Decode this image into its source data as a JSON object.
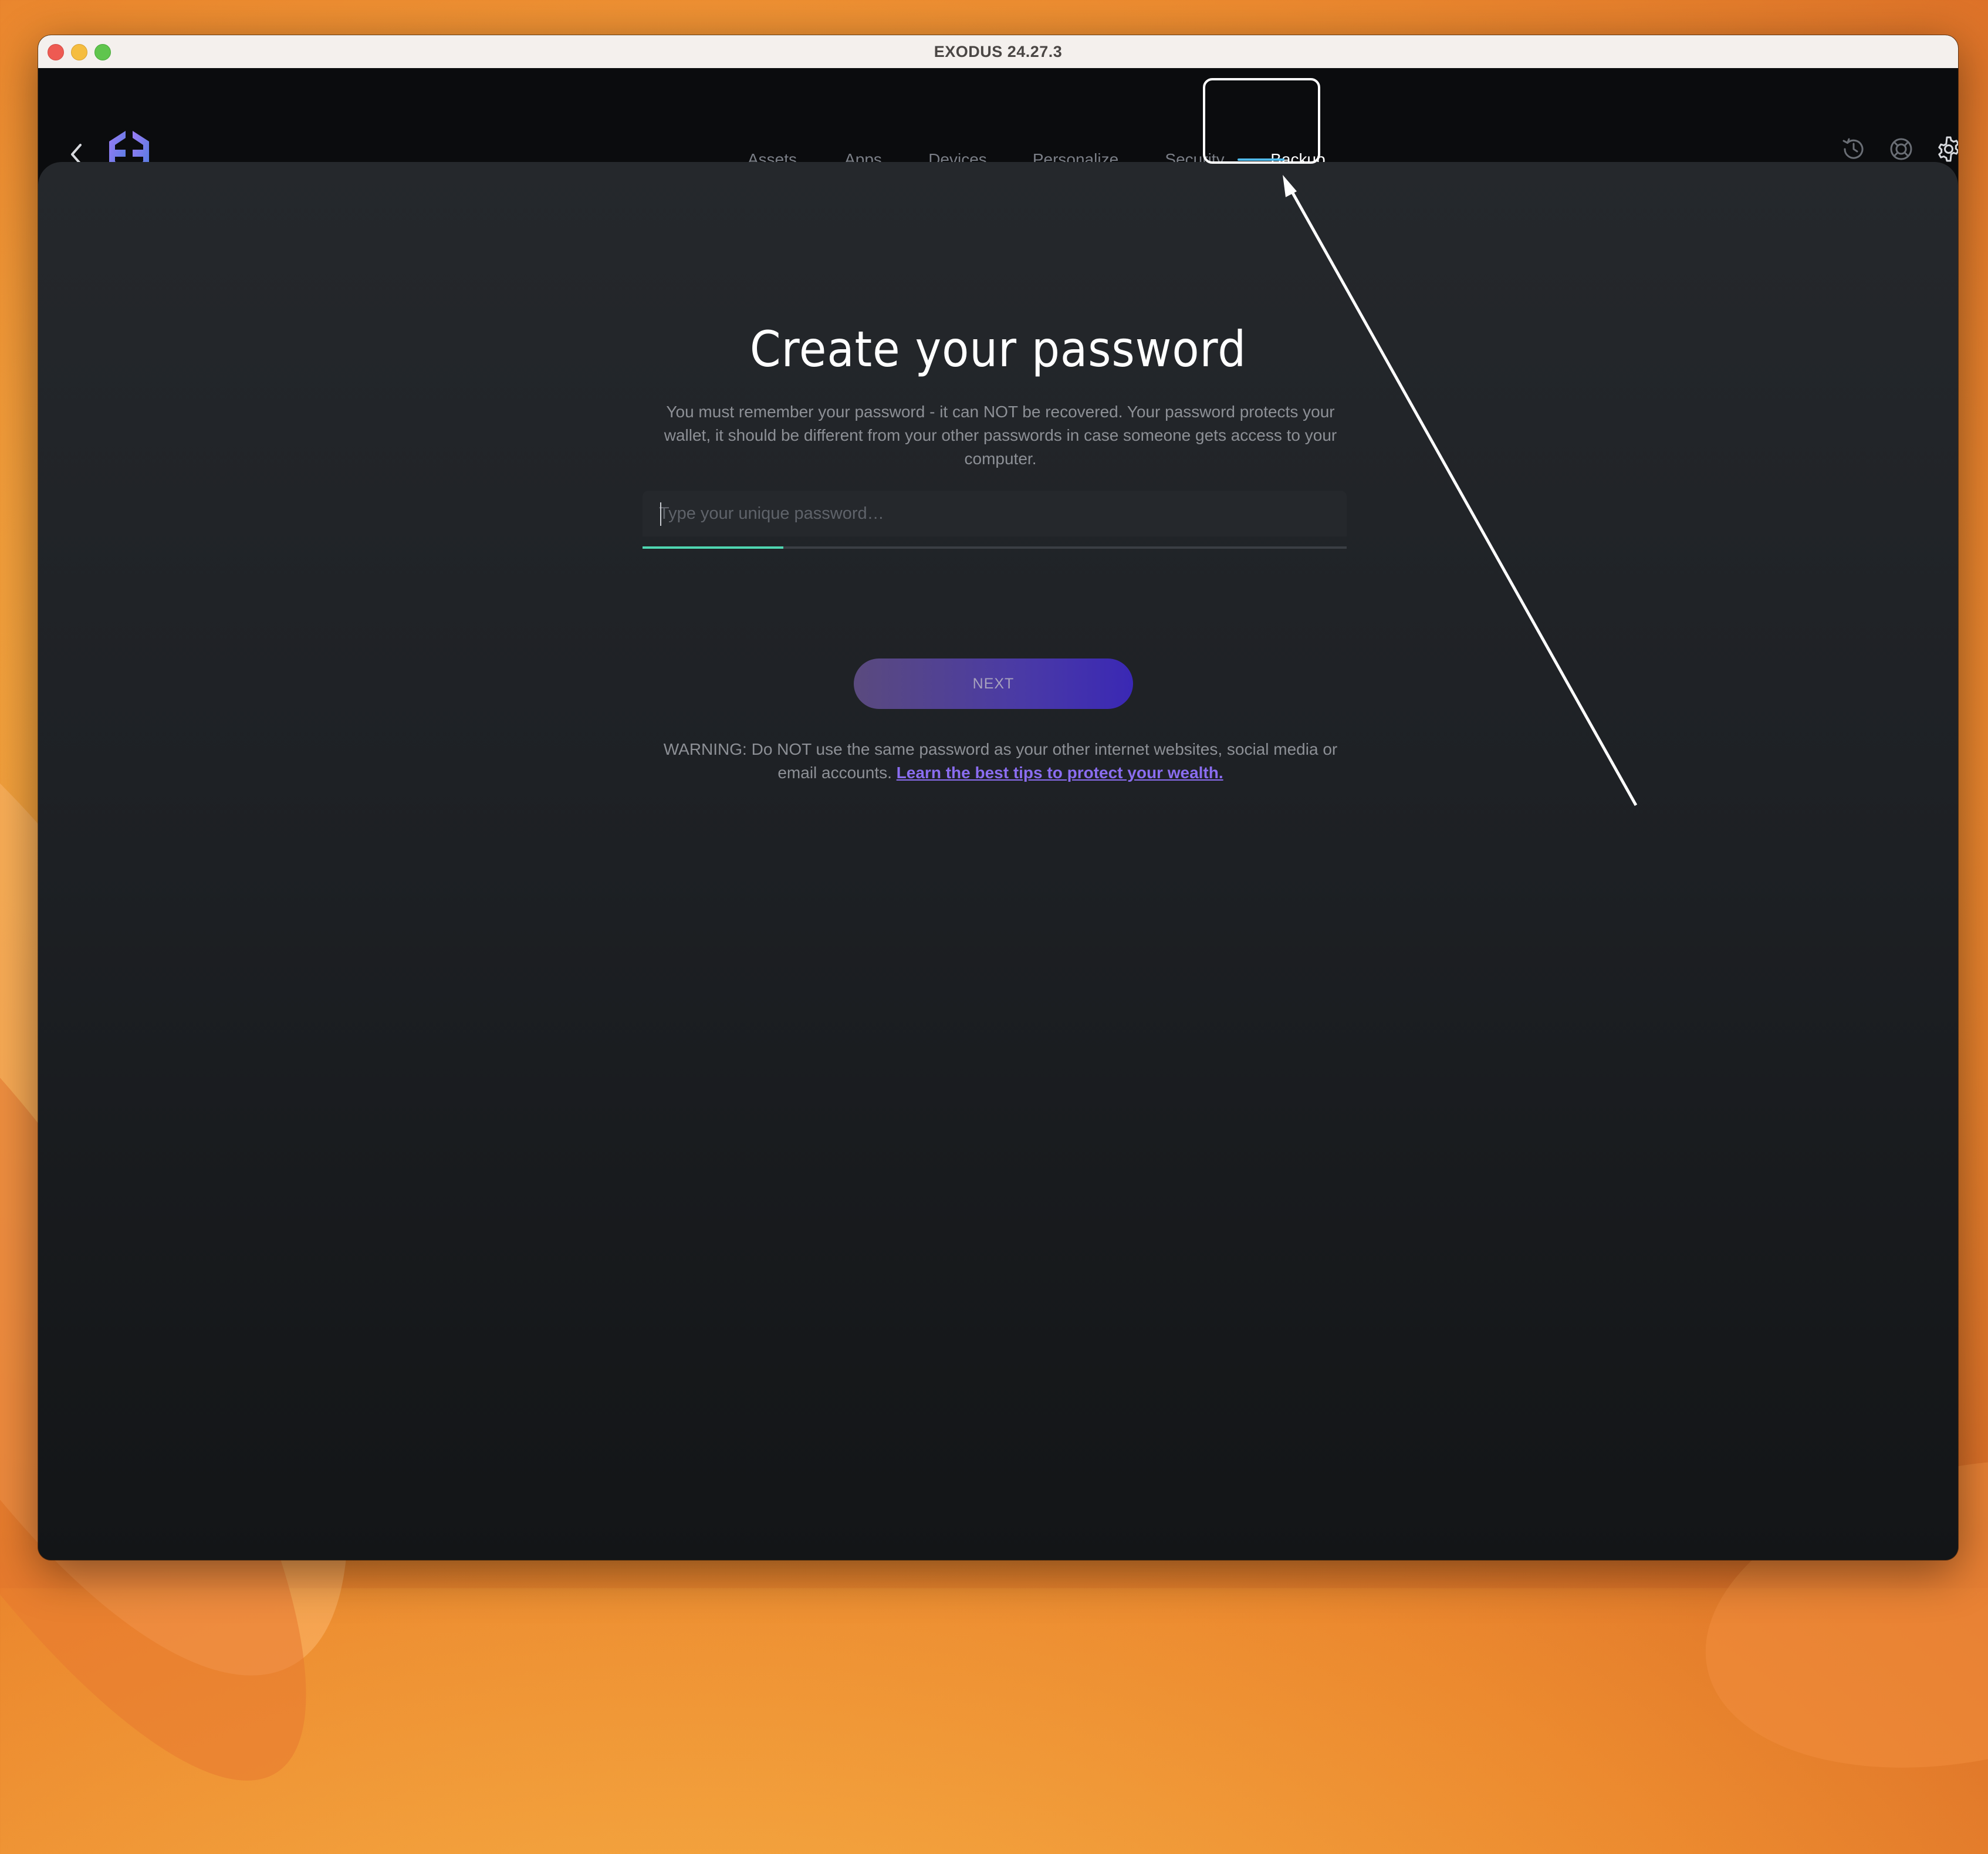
{
  "window": {
    "title": "EXODUS 24.27.3"
  },
  "nav": {
    "items": [
      {
        "label": "Assets",
        "active": false
      },
      {
        "label": "Apps",
        "active": false
      },
      {
        "label": "Devices",
        "active": false
      },
      {
        "label": "Personalize",
        "active": false
      },
      {
        "label": "Security",
        "active": false
      },
      {
        "label": "Backup",
        "active": true
      }
    ]
  },
  "toolbar": {
    "icons": [
      "back-arrow-icon",
      "exodus-logo-icon",
      "history-icon",
      "help-lifebuoy-icon",
      "settings-gear-icon"
    ]
  },
  "main": {
    "heading": "Create your password",
    "description": "You must remember your password - it can NOT be recovered. Your password protects your wallet, it should be different from your other passwords in case someone gets access to your computer.",
    "password_input": {
      "value": "",
      "placeholder": "Type your unique password…"
    },
    "strength_level": 0.2,
    "next_button": "NEXT",
    "warning_text": "WARNING: Do NOT use the same password as your other internet websites, social media or email accounts.",
    "warning_link": "Learn the best tips to protect your wealth."
  },
  "colors": {
    "accent_underline": "#4fb8e8",
    "strength_fill": "#4fd6b1",
    "link": "#8a6df0",
    "button_gradient_start": "#5a4a7e",
    "button_gradient_end": "#3a28b4"
  }
}
